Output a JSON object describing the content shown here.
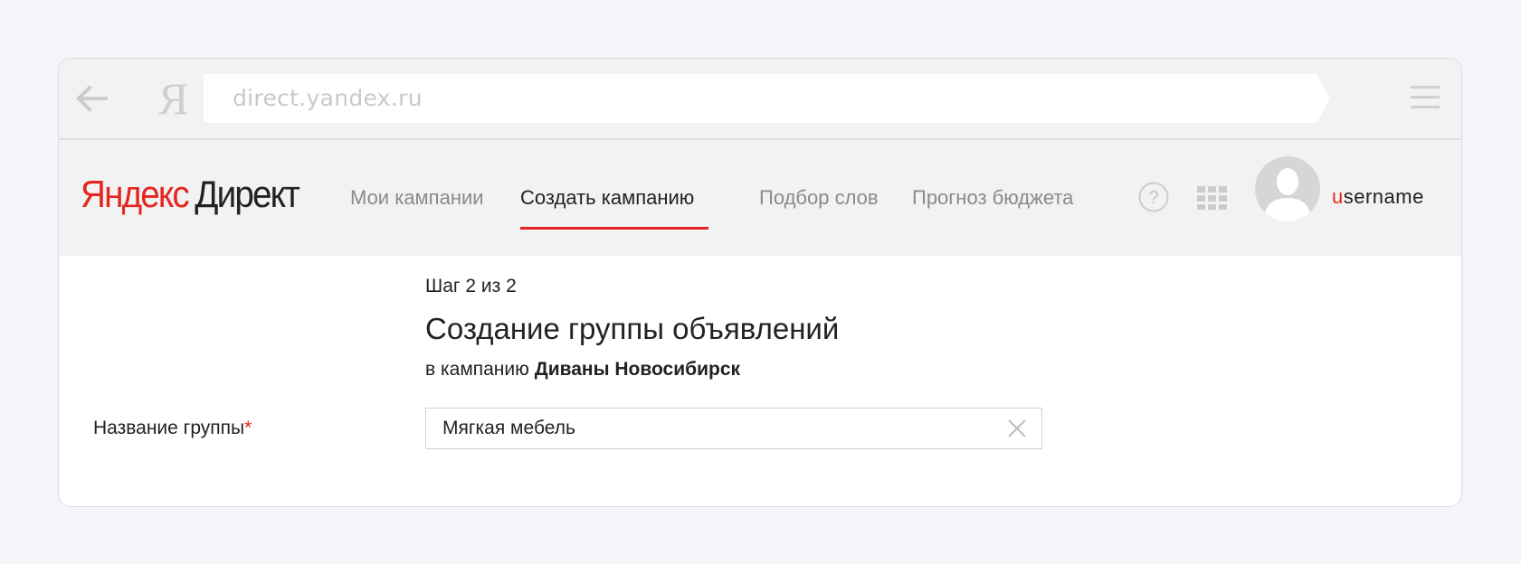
{
  "browser": {
    "url": "direct.yandex.ru",
    "ya_glyph": "Я"
  },
  "header": {
    "logo_brand": "Яндекс",
    "logo_product": "Директ",
    "nav": [
      {
        "label": "Мои кампании",
        "active": false
      },
      {
        "label": "Создать кампанию",
        "active": true
      },
      {
        "label": "Подбор слов",
        "active": false
      },
      {
        "label": "Прогноз бюджета",
        "active": false
      }
    ],
    "user": {
      "first_letter": "u",
      "rest": "sername"
    }
  },
  "main": {
    "step": "Шаг 2 из 2",
    "title": "Создание группы объявлений",
    "subtitle_prefix": "в кампанию",
    "campaign_name": "Диваны Новосибирск",
    "group_name_label": "Название группы",
    "required_mark": "*",
    "group_name_value": "Мягкая мебель"
  },
  "icons": {
    "back": "arrow-left-icon",
    "menu": "hamburger-menu-icon",
    "help": "question-mark-icon",
    "apps": "grid-apps-icon",
    "avatar": "user-avatar-icon",
    "clear": "close-icon"
  },
  "colors": {
    "accent": "#e52620",
    "chrome_bg": "#f2f2f2",
    "page_bg": "#f3f5f8"
  }
}
